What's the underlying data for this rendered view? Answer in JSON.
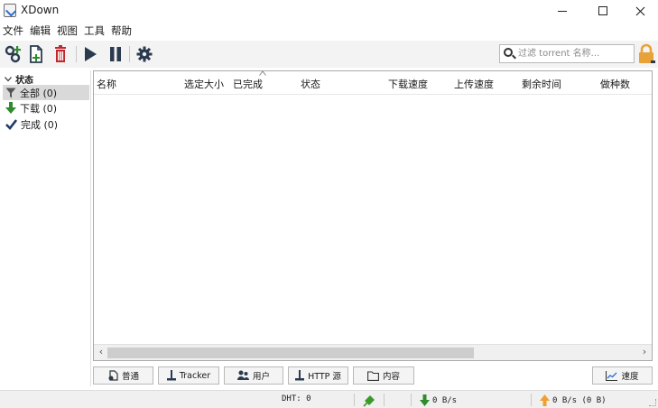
{
  "window": {
    "title": "XDown"
  },
  "menu": {
    "items": [
      "文件",
      "编辑",
      "视图",
      "工具",
      "帮助"
    ]
  },
  "toolbar": {
    "icons": [
      "add-torrent-icon",
      "new-file-icon",
      "delete-icon",
      "play-icon",
      "pause-icon",
      "settings-icon"
    ]
  },
  "search": {
    "placeholder": "过滤 torrent 名称..."
  },
  "sidebar": {
    "heading": "状态",
    "items": [
      {
        "label": "全部 (0)",
        "icon": "filter-icon"
      },
      {
        "label": "下载 (0)",
        "icon": "download-arrow-icon"
      },
      {
        "label": "完成 (0)",
        "icon": "checkmark-icon"
      }
    ]
  },
  "table": {
    "columns": [
      "名称",
      "选定大小",
      "已完成",
      "状态",
      "下载速度",
      "上传速度",
      "剩余时间",
      "做种数"
    ],
    "rows": []
  },
  "tabs": [
    "普通",
    "Tracker",
    "用户",
    "HTTP 源",
    "内容",
    "速度"
  ],
  "status": {
    "dht": "DHT: 0",
    "download": "0 B/s",
    "upload": "0 B/s (0 B)"
  },
  "colors": {
    "delete": "#c1272d",
    "toolbar_dark": "#2a3a4f",
    "download": "#2e8b2e",
    "upload": "#f0a030",
    "lock": "#e8a23a"
  }
}
